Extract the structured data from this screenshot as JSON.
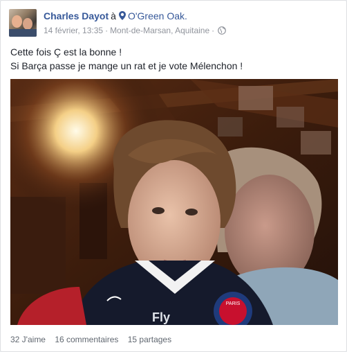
{
  "post": {
    "author": "Charles Dayot",
    "at": "à",
    "place": "O'Green Oak.",
    "date": "14 février, 13:35",
    "location": "Mont-de-Marsan, Aquitaine",
    "separator": "·",
    "privacy_icon": "globe-icon",
    "text_line1": "Cette fois Ç est la bonne !",
    "text_line2": "Si Barça passe je mange un rat et je vote Mélenchon !"
  },
  "photo": {
    "jersey_text": "PARIS",
    "jersey_partial": "Fly"
  },
  "stats": {
    "likes": "32 J'aime",
    "comments": "16 commentaires",
    "shares": "15 partages"
  },
  "colors": {
    "link": "#365899",
    "text": "#1d2129",
    "meta": "#90949c"
  }
}
